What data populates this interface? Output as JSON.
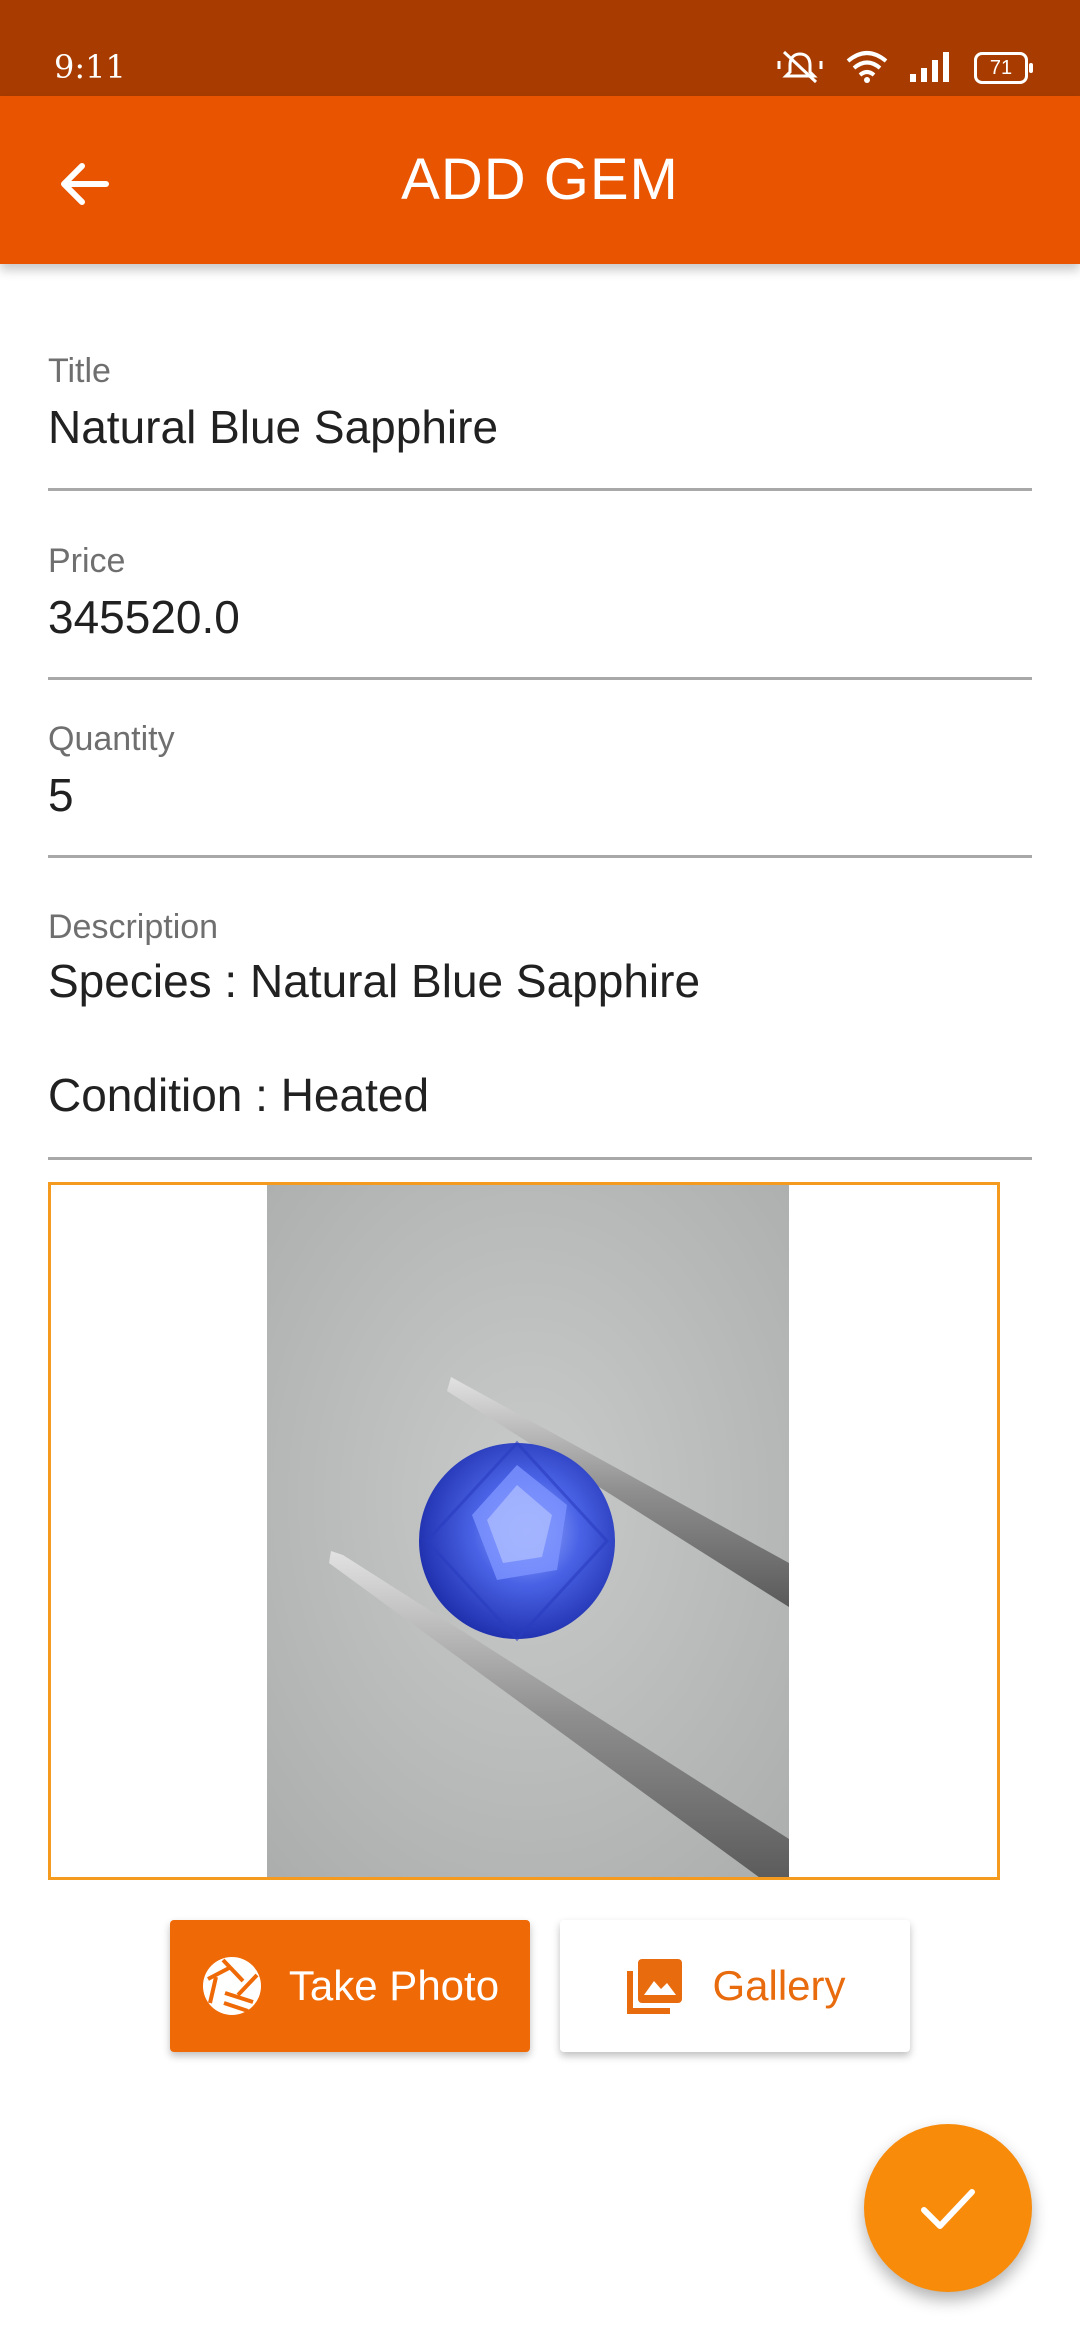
{
  "status_bar": {
    "time": "9:11",
    "battery": "71",
    "icons": [
      "mute-icon",
      "wifi-icon",
      "signal-icon",
      "battery-icon"
    ]
  },
  "app_bar": {
    "title": "ADD GEM",
    "back_icon": "arrow-left-icon"
  },
  "form": {
    "title": {
      "label": "Title",
      "value": "Natural Blue Sapphire"
    },
    "price": {
      "label": "Price",
      "value": "345520.0"
    },
    "quantity": {
      "label": "Quantity",
      "value": "5"
    },
    "description": {
      "label": "Description",
      "line1": "Species : Natural Blue Sapphire",
      "line2": "Condition : Heated"
    }
  },
  "image": {
    "subject": "blue-sapphire-in-tweezers"
  },
  "buttons": {
    "take_photo": {
      "label": "Take Photo",
      "icon": "camera-shutter-icon"
    },
    "gallery": {
      "label": "Gallery",
      "icon": "gallery-icon"
    }
  },
  "fab": {
    "icon": "check-icon"
  },
  "colors": {
    "status_bar": "#a83c00",
    "app_bar": "#e85400",
    "accent": "#ef6a06",
    "fab": "#f88b0a",
    "frame": "#f39a1f"
  }
}
